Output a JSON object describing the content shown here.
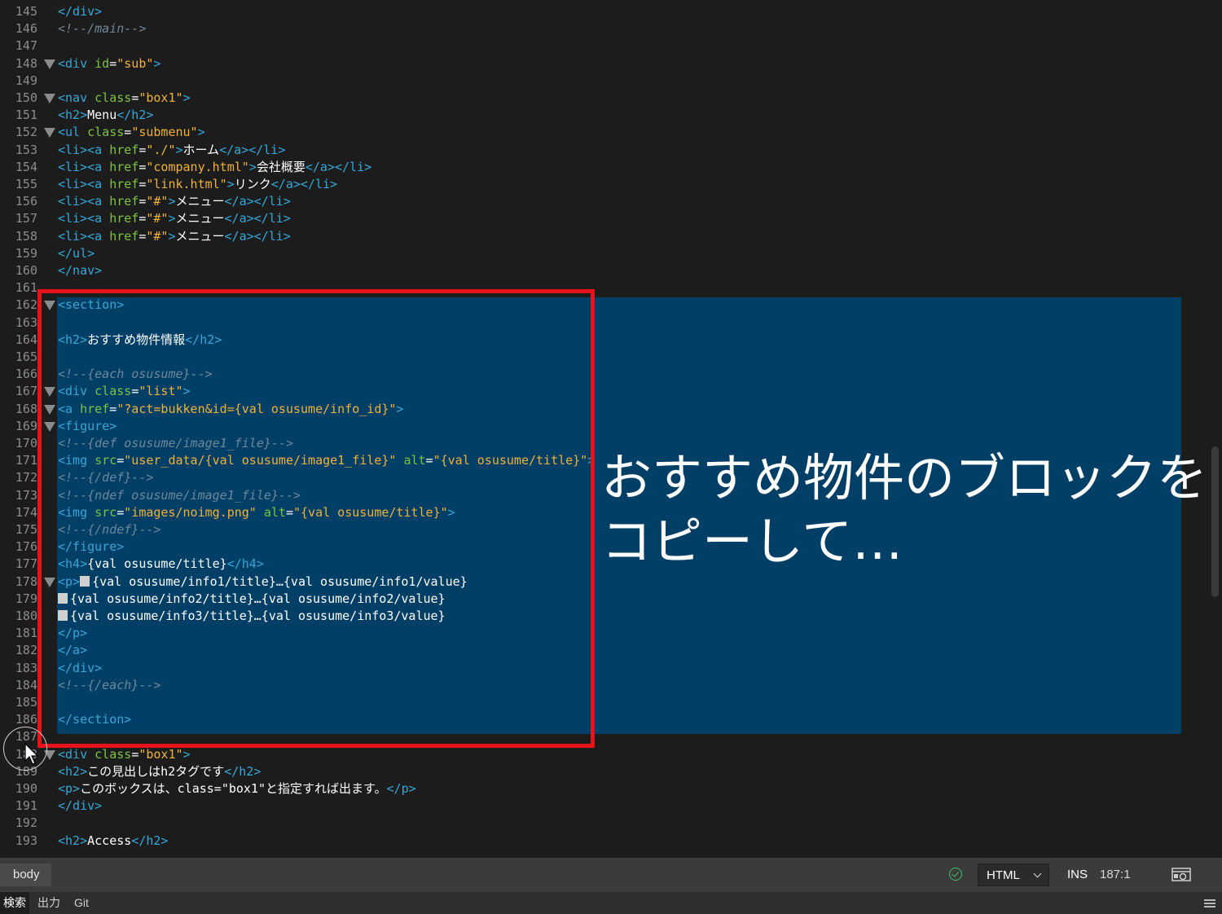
{
  "editor": {
    "lines": [
      {
        "num": "145",
        "fold": false,
        "segs": [
          {
            "t": "tag",
            "v": "</div>"
          }
        ]
      },
      {
        "num": "146",
        "fold": false,
        "segs": [
          {
            "t": "cmt",
            "v": "<!--/main-->"
          }
        ]
      },
      {
        "num": "147",
        "fold": false,
        "segs": []
      },
      {
        "num": "148",
        "fold": true,
        "segs": [
          {
            "t": "tag",
            "v": "<div "
          },
          {
            "t": "attr",
            "v": "id"
          },
          {
            "t": "txt",
            "v": "="
          },
          {
            "t": "str",
            "v": "\"sub\""
          },
          {
            "t": "tag",
            "v": ">"
          }
        ]
      },
      {
        "num": "149",
        "fold": false,
        "segs": []
      },
      {
        "num": "150",
        "fold": true,
        "segs": [
          {
            "t": "tag",
            "v": "<nav "
          },
          {
            "t": "attr",
            "v": "class"
          },
          {
            "t": "txt",
            "v": "="
          },
          {
            "t": "str",
            "v": "\"box1\""
          },
          {
            "t": "tag",
            "v": ">"
          }
        ]
      },
      {
        "num": "151",
        "fold": false,
        "segs": [
          {
            "t": "tag",
            "v": "<h2>"
          },
          {
            "t": "txt",
            "v": "Menu"
          },
          {
            "t": "tag",
            "v": "</h2>"
          }
        ]
      },
      {
        "num": "152",
        "fold": true,
        "segs": [
          {
            "t": "tag",
            "v": "<ul "
          },
          {
            "t": "attr",
            "v": "class"
          },
          {
            "t": "txt",
            "v": "="
          },
          {
            "t": "str",
            "v": "\"submenu\""
          },
          {
            "t": "tag",
            "v": ">"
          }
        ]
      },
      {
        "num": "153",
        "fold": false,
        "segs": [
          {
            "t": "tag",
            "v": "<li><a "
          },
          {
            "t": "attr",
            "v": "href"
          },
          {
            "t": "txt",
            "v": "="
          },
          {
            "t": "str",
            "v": "\"./\""
          },
          {
            "t": "tag",
            "v": ">"
          },
          {
            "t": "txt",
            "v": "ホーム"
          },
          {
            "t": "tag",
            "v": "</a></li>"
          }
        ]
      },
      {
        "num": "154",
        "fold": false,
        "segs": [
          {
            "t": "tag",
            "v": "<li><a "
          },
          {
            "t": "attr",
            "v": "href"
          },
          {
            "t": "txt",
            "v": "="
          },
          {
            "t": "str",
            "v": "\"company.html\""
          },
          {
            "t": "tag",
            "v": ">"
          },
          {
            "t": "txt",
            "v": "会社概要"
          },
          {
            "t": "tag",
            "v": "</a></li>"
          }
        ]
      },
      {
        "num": "155",
        "fold": false,
        "segs": [
          {
            "t": "tag",
            "v": "<li><a "
          },
          {
            "t": "attr",
            "v": "href"
          },
          {
            "t": "txt",
            "v": "="
          },
          {
            "t": "str",
            "v": "\"link.html\""
          },
          {
            "t": "tag",
            "v": ">"
          },
          {
            "t": "txt",
            "v": "リンク"
          },
          {
            "t": "tag",
            "v": "</a></li>"
          }
        ]
      },
      {
        "num": "156",
        "fold": false,
        "segs": [
          {
            "t": "tag",
            "v": "<li><a "
          },
          {
            "t": "attr",
            "v": "href"
          },
          {
            "t": "txt",
            "v": "="
          },
          {
            "t": "str",
            "v": "\"#\""
          },
          {
            "t": "tag",
            "v": ">"
          },
          {
            "t": "txt",
            "v": "メニュー"
          },
          {
            "t": "tag",
            "v": "</a></li>"
          }
        ]
      },
      {
        "num": "157",
        "fold": false,
        "segs": [
          {
            "t": "tag",
            "v": "<li><a "
          },
          {
            "t": "attr",
            "v": "href"
          },
          {
            "t": "txt",
            "v": "="
          },
          {
            "t": "str",
            "v": "\"#\""
          },
          {
            "t": "tag",
            "v": ">"
          },
          {
            "t": "txt",
            "v": "メニュー"
          },
          {
            "t": "tag",
            "v": "</a></li>"
          }
        ]
      },
      {
        "num": "158",
        "fold": false,
        "segs": [
          {
            "t": "tag",
            "v": "<li><a "
          },
          {
            "t": "attr",
            "v": "href"
          },
          {
            "t": "txt",
            "v": "="
          },
          {
            "t": "str",
            "v": "\"#\""
          },
          {
            "t": "tag",
            "v": ">"
          },
          {
            "t": "txt",
            "v": "メニュー"
          },
          {
            "t": "tag",
            "v": "</a></li>"
          }
        ]
      },
      {
        "num": "159",
        "fold": false,
        "segs": [
          {
            "t": "tag",
            "v": "</ul>"
          }
        ]
      },
      {
        "num": "160",
        "fold": false,
        "segs": [
          {
            "t": "tag",
            "v": "</nav>"
          }
        ]
      },
      {
        "num": "161",
        "fold": false,
        "segs": []
      },
      {
        "num": "162",
        "fold": true,
        "segs": [
          {
            "t": "tag",
            "v": "<section>"
          }
        ]
      },
      {
        "num": "163",
        "fold": false,
        "segs": []
      },
      {
        "num": "164",
        "fold": false,
        "segs": [
          {
            "t": "tag",
            "v": "<h2>"
          },
          {
            "t": "txt",
            "v": "おすすめ物件情報"
          },
          {
            "t": "tag",
            "v": "</h2>"
          }
        ]
      },
      {
        "num": "165",
        "fold": false,
        "segs": []
      },
      {
        "num": "166",
        "fold": false,
        "segs": [
          {
            "t": "cmt",
            "v": "<!--{each osusume}-->"
          }
        ]
      },
      {
        "num": "167",
        "fold": true,
        "segs": [
          {
            "t": "tag",
            "v": "<div "
          },
          {
            "t": "attr",
            "v": "class"
          },
          {
            "t": "txt",
            "v": "="
          },
          {
            "t": "str",
            "v": "\"list\""
          },
          {
            "t": "tag",
            "v": ">"
          }
        ]
      },
      {
        "num": "168",
        "fold": true,
        "segs": [
          {
            "t": "tag",
            "v": "<a "
          },
          {
            "t": "attr",
            "v": "href"
          },
          {
            "t": "txt",
            "v": "="
          },
          {
            "t": "str",
            "v": "\"?act=bukken&id={val osusume/info_id}\""
          },
          {
            "t": "tag",
            "v": ">"
          }
        ]
      },
      {
        "num": "169",
        "fold": true,
        "segs": [
          {
            "t": "tag",
            "v": "<figure>"
          }
        ]
      },
      {
        "num": "170",
        "fold": false,
        "segs": [
          {
            "t": "cmt",
            "v": "<!--{def osusume/image1_file}-->"
          }
        ]
      },
      {
        "num": "171",
        "fold": false,
        "segs": [
          {
            "t": "tag",
            "v": "<img "
          },
          {
            "t": "attr",
            "v": "src"
          },
          {
            "t": "txt",
            "v": "="
          },
          {
            "t": "str",
            "v": "\"user_data/{val osusume/image1_file}\""
          },
          {
            "t": "txt",
            "v": " "
          },
          {
            "t": "attr",
            "v": "alt"
          },
          {
            "t": "txt",
            "v": "="
          },
          {
            "t": "str",
            "v": "\"{val osusume/title}\""
          },
          {
            "t": "tag",
            "v": ">"
          }
        ]
      },
      {
        "num": "172",
        "fold": false,
        "segs": [
          {
            "t": "cmt",
            "v": "<!--{/def}-->"
          }
        ]
      },
      {
        "num": "173",
        "fold": false,
        "segs": [
          {
            "t": "cmt",
            "v": "<!--{ndef osusume/image1_file}-->"
          }
        ]
      },
      {
        "num": "174",
        "fold": false,
        "segs": [
          {
            "t": "tag",
            "v": "<img "
          },
          {
            "t": "attr",
            "v": "src"
          },
          {
            "t": "txt",
            "v": "="
          },
          {
            "t": "str",
            "v": "\"images/noimg.png\""
          },
          {
            "t": "txt",
            "v": " "
          },
          {
            "t": "attr",
            "v": "alt"
          },
          {
            "t": "txt",
            "v": "="
          },
          {
            "t": "str",
            "v": "\"{val osusume/title}\""
          },
          {
            "t": "tag",
            "v": ">"
          }
        ]
      },
      {
        "num": "175",
        "fold": false,
        "segs": [
          {
            "t": "cmt",
            "v": "<!--{/ndef}-->"
          }
        ]
      },
      {
        "num": "176",
        "fold": false,
        "segs": [
          {
            "t": "tag",
            "v": "</figure>"
          }
        ]
      },
      {
        "num": "177",
        "fold": false,
        "segs": [
          {
            "t": "tag",
            "v": "<h4>"
          },
          {
            "t": "txt",
            "v": "{val osusume/title}"
          },
          {
            "t": "tag",
            "v": "</h4>"
          }
        ]
      },
      {
        "num": "178",
        "fold": true,
        "segs": [
          {
            "t": "tag",
            "v": "<p>"
          },
          {
            "t": "sq",
            "v": ""
          },
          {
            "t": "txt",
            "v": "{val osusume/info1/title}…{val osusume/info1/value}"
          }
        ]
      },
      {
        "num": "179",
        "fold": false,
        "segs": [
          {
            "t": "sq",
            "v": ""
          },
          {
            "t": "txt",
            "v": "{val osusume/info2/title}…{val osusume/info2/value}"
          }
        ]
      },
      {
        "num": "180",
        "fold": false,
        "segs": [
          {
            "t": "sq",
            "v": ""
          },
          {
            "t": "txt",
            "v": "{val osusume/info3/title}…{val osusume/info3/value}"
          }
        ]
      },
      {
        "num": "181",
        "fold": false,
        "segs": [
          {
            "t": "tag",
            "v": "</p>"
          }
        ]
      },
      {
        "num": "182",
        "fold": false,
        "segs": [
          {
            "t": "tag",
            "v": "</a>"
          }
        ]
      },
      {
        "num": "183",
        "fold": false,
        "segs": [
          {
            "t": "tag",
            "v": "</div>"
          }
        ]
      },
      {
        "num": "184",
        "fold": false,
        "segs": [
          {
            "t": "cmt",
            "v": "<!--{/each}-->"
          }
        ]
      },
      {
        "num": "185",
        "fold": false,
        "segs": []
      },
      {
        "num": "186",
        "fold": false,
        "segs": [
          {
            "t": "tag",
            "v": "</section>"
          }
        ]
      },
      {
        "num": "187",
        "fold": false,
        "segs": []
      },
      {
        "num": "188",
        "fold": true,
        "segs": [
          {
            "t": "tag",
            "v": "<div "
          },
          {
            "t": "attr",
            "v": "class"
          },
          {
            "t": "txt",
            "v": "="
          },
          {
            "t": "str",
            "v": "\"box1\""
          },
          {
            "t": "tag",
            "v": ">"
          }
        ]
      },
      {
        "num": "189",
        "fold": false,
        "segs": [
          {
            "t": "tag",
            "v": "<h2>"
          },
          {
            "t": "txt",
            "v": "この見出しはh2タグです"
          },
          {
            "t": "tag",
            "v": "</h2>"
          }
        ]
      },
      {
        "num": "190",
        "fold": false,
        "segs": [
          {
            "t": "tag",
            "v": "<p>"
          },
          {
            "t": "txt",
            "v": "このボックスは、class=\"box1\"と指定すれば出ます。"
          },
          {
            "t": "tag",
            "v": "</p>"
          }
        ]
      },
      {
        "num": "191",
        "fold": false,
        "segs": [
          {
            "t": "tag",
            "v": "</div>"
          }
        ]
      },
      {
        "num": "192",
        "fold": false,
        "segs": []
      },
      {
        "num": "193",
        "fold": false,
        "segs": [
          {
            "t": "tag",
            "v": "<h2>"
          },
          {
            "t": "txt",
            "v": "Access"
          },
          {
            "t": "tag",
            "v": "</h2>"
          }
        ]
      }
    ]
  },
  "annotation": {
    "caption": "おすすめ物件のブロックを\nコピーして…",
    "box_color": "#e8121b"
  },
  "colors": {
    "background": "#1c1c1c",
    "selection": "#023f66",
    "tag": "#35a8d8",
    "attribute": "#7dc342",
    "string": "#f0b23a",
    "comment": "#6f8799"
  },
  "statusbar": {
    "breadcrumb": "body",
    "status_icon": "check-circle-icon",
    "language": "HTML",
    "mode": "INS",
    "cursor_position": "187:1",
    "preview_icon": "live-preview-icon"
  },
  "panel": {
    "tabs": [
      {
        "label": "検索",
        "active": true
      },
      {
        "label": "出力",
        "active": false
      },
      {
        "label": "Git",
        "active": false
      }
    ],
    "menu_icon": "hamburger-menu-icon"
  }
}
